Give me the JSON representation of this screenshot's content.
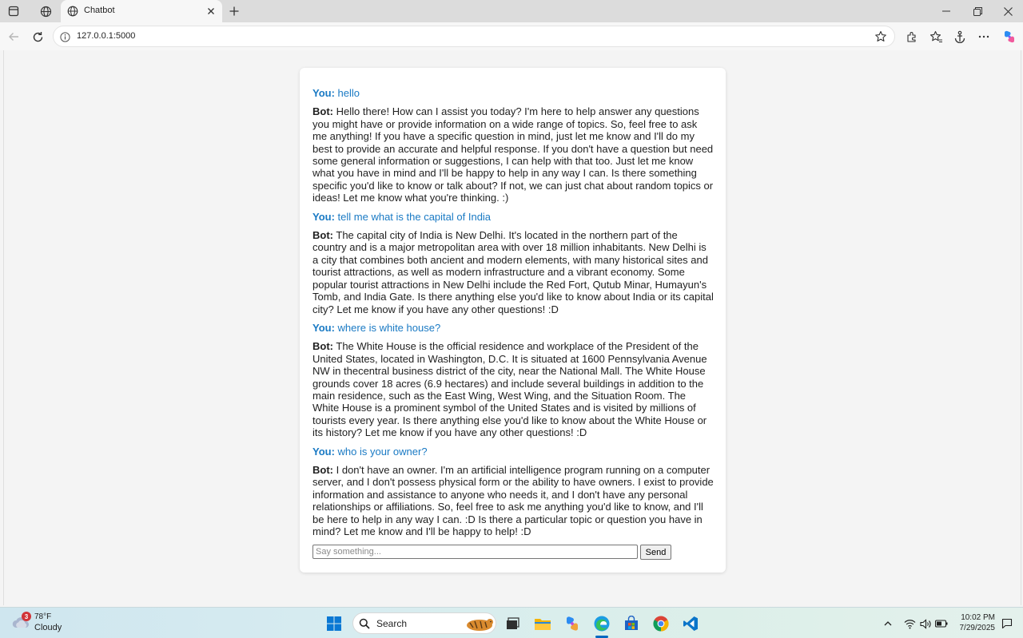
{
  "browser": {
    "tab_title": "Chatbot",
    "url": "127.0.0.1:5000"
  },
  "chat": {
    "messages": [
      {
        "speaker": "You:",
        "role": "user",
        "text": "hello"
      },
      {
        "speaker": "Bot:",
        "role": "bot",
        "text": "Hello there! How can I assist you today? I'm here to help answer any questions you might have or provide information on a wide range of topics. So, feel free to ask me anything! If you have a specific question in mind, just let me know and I'll do my best to provide an accurate and helpful response. If you don't have a question but need some general information or suggestions, I can help with that too. Just let me know what you have in mind and I'll be happy to help in any way I can. Is there something specific you'd like to know or talk about? If not, we can just chat about random topics or ideas! Let me know what you're thinking. :)"
      },
      {
        "speaker": "You:",
        "role": "user",
        "text": "tell me what is the capital of India"
      },
      {
        "speaker": "Bot:",
        "role": "bot",
        "text": "The capital city of India is New Delhi. It's located in the northern part of the country and is a major metropolitan area with over 18 million inhabitants. New Delhi is a city that combines both ancient and modern elements, with many historical sites and tourist attractions, as well as modern infrastructure and a vibrant economy. Some popular tourist attractions in New Delhi include the Red Fort, Qutub Minar, Humayun's Tomb, and India Gate. Is there anything else you'd like to know about India or its capital city? Let me know if you have any other questions! :D"
      },
      {
        "speaker": "You:",
        "role": "user",
        "text": "where is white house?"
      },
      {
        "speaker": "Bot:",
        "role": "bot",
        "text": "The White House is the official residence and workplace of the President of the United States, located in Washington, D.C. It is situated at 1600 Pennsylvania Avenue NW in thecentral business district of the city, near the National Mall. The White House grounds cover 18 acres (6.9 hectares) and include several buildings in addition to the main residence, such as the East Wing, West Wing, and the Situation Room. The White House is a prominent symbol of the United States and is visited by millions of tourists every year. Is there anything else you'd like to know about the White House or its history? Let me know if you have any other questions! :D"
      },
      {
        "speaker": "You:",
        "role": "user",
        "text": "who is your owner?"
      },
      {
        "speaker": "Bot:",
        "role": "bot",
        "text": "I don't have an owner. I'm an artificial intelligence program running on a computer server, and I don't possess physical form or the ability to have owners. I exist to provide information and assistance to anyone who needs it, and I don't have any personal relationships or affiliations. So, feel free to ask me anything you'd like to know, and I'll be here to help in any way I can. :D Is there a particular topic or question you have in mind? Let me know and I'll be happy to help! :D"
      }
    ],
    "input": {
      "placeholder": "Say something...",
      "value": ""
    },
    "send_label": "Send"
  },
  "taskbar": {
    "weather": {
      "temp": "78°F",
      "condition": "Cloudy",
      "badge": "3"
    },
    "search_label": "Search",
    "time": "10:02 PM",
    "date": "7/29/2025"
  },
  "colors": {
    "user_text": "#1a7ac4",
    "bot_text": "#1f1f1f",
    "accent": "#0067c0"
  },
  "icons": {
    "browser": [
      "sidebar-toggle-icon",
      "workspaces-icon",
      "globe-icon",
      "close-icon",
      "plus-icon",
      "minimize-icon",
      "restore-icon",
      "close-window-icon",
      "back-icon",
      "reload-icon",
      "info-icon",
      "star-icon",
      "extensions-icon",
      "favorites-icon",
      "anchor-icon",
      "more-icon",
      "copilot-icon"
    ],
    "taskbar": [
      "start-icon",
      "search-icon",
      "task-view-icon",
      "file-explorer-icon",
      "copilot-icon",
      "edge-icon",
      "store-icon",
      "chrome-icon",
      "vscode-icon",
      "chevron-up-icon",
      "wifi-icon",
      "volume-icon",
      "battery-icon",
      "notification-icon"
    ]
  }
}
